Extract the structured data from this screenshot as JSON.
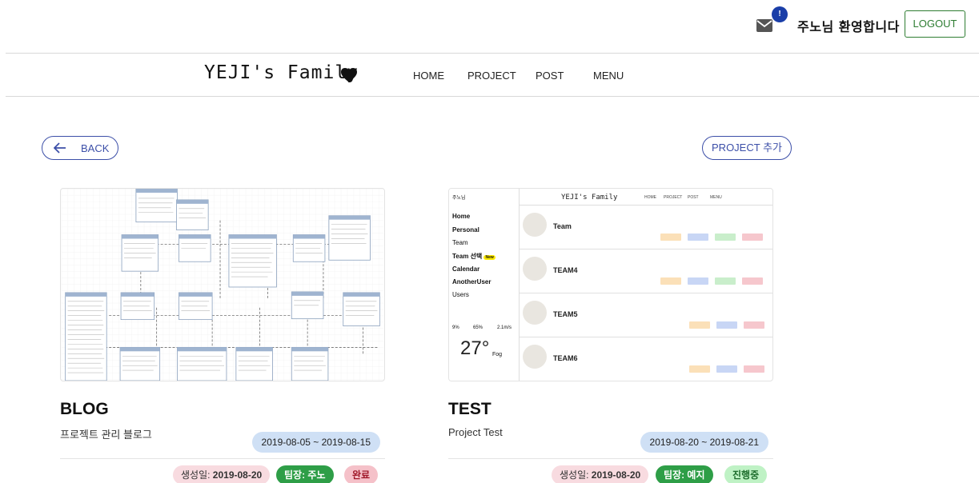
{
  "header": {
    "mail_icon": "envelope-icon",
    "mail_badge": "!",
    "welcome": "주노님 환영합니다",
    "logout_label": "LOGOUT"
  },
  "nav": {
    "brand": "YEJI's Family",
    "brand_icon": "heart-icon",
    "items": [
      "HOME",
      "PROJECT",
      "POST",
      "MENU"
    ]
  },
  "actions": {
    "back_label": "BACK",
    "back_icon": "arrow-left-icon",
    "add_label": "PROJECT 추가"
  },
  "projects": [
    {
      "title": "BLOG",
      "description": "프로젝트 관리 블로그",
      "period": "2019-08-05 ~ 2019-08-15",
      "created_label": "생성일: ",
      "created_value": "2019-08-20",
      "leader": "팀장: 주노",
      "status": "완료"
    },
    {
      "title": "TEST",
      "description": "Project Test",
      "period": "2019-08-20 ~ 2019-08-21",
      "created_label": "생성일: ",
      "created_value": "2019-08-20",
      "leader": "팀장: 예지",
      "status": "진행중"
    }
  ],
  "test_preview": {
    "side_user": "주노님",
    "side_items": [
      "Home",
      "Personal",
      "Team",
      "Team 선택",
      "Calendar",
      "AnotherUser",
      "Users"
    ],
    "new_badge": "New",
    "weather_stats": [
      "9%",
      "65%",
      "2.1m/s"
    ],
    "temperature": "27°",
    "condition": "Fog",
    "brand": "YEJI's Family",
    "nav": [
      "HOME",
      "PROJECT",
      "POST",
      "MENU"
    ],
    "teams": [
      "Team",
      "TEAM4",
      "TEAM5",
      "TEAM6"
    ]
  },
  "colors": {
    "accent": "#3c4fa8",
    "logout": "#2e7d32",
    "badge": "#1a3ea8",
    "period_pill": "#cfe0f5",
    "leader_pill": "#2e9e47",
    "done_pill": "#f5c1c9",
    "progress_pill": "#bff2c5"
  }
}
